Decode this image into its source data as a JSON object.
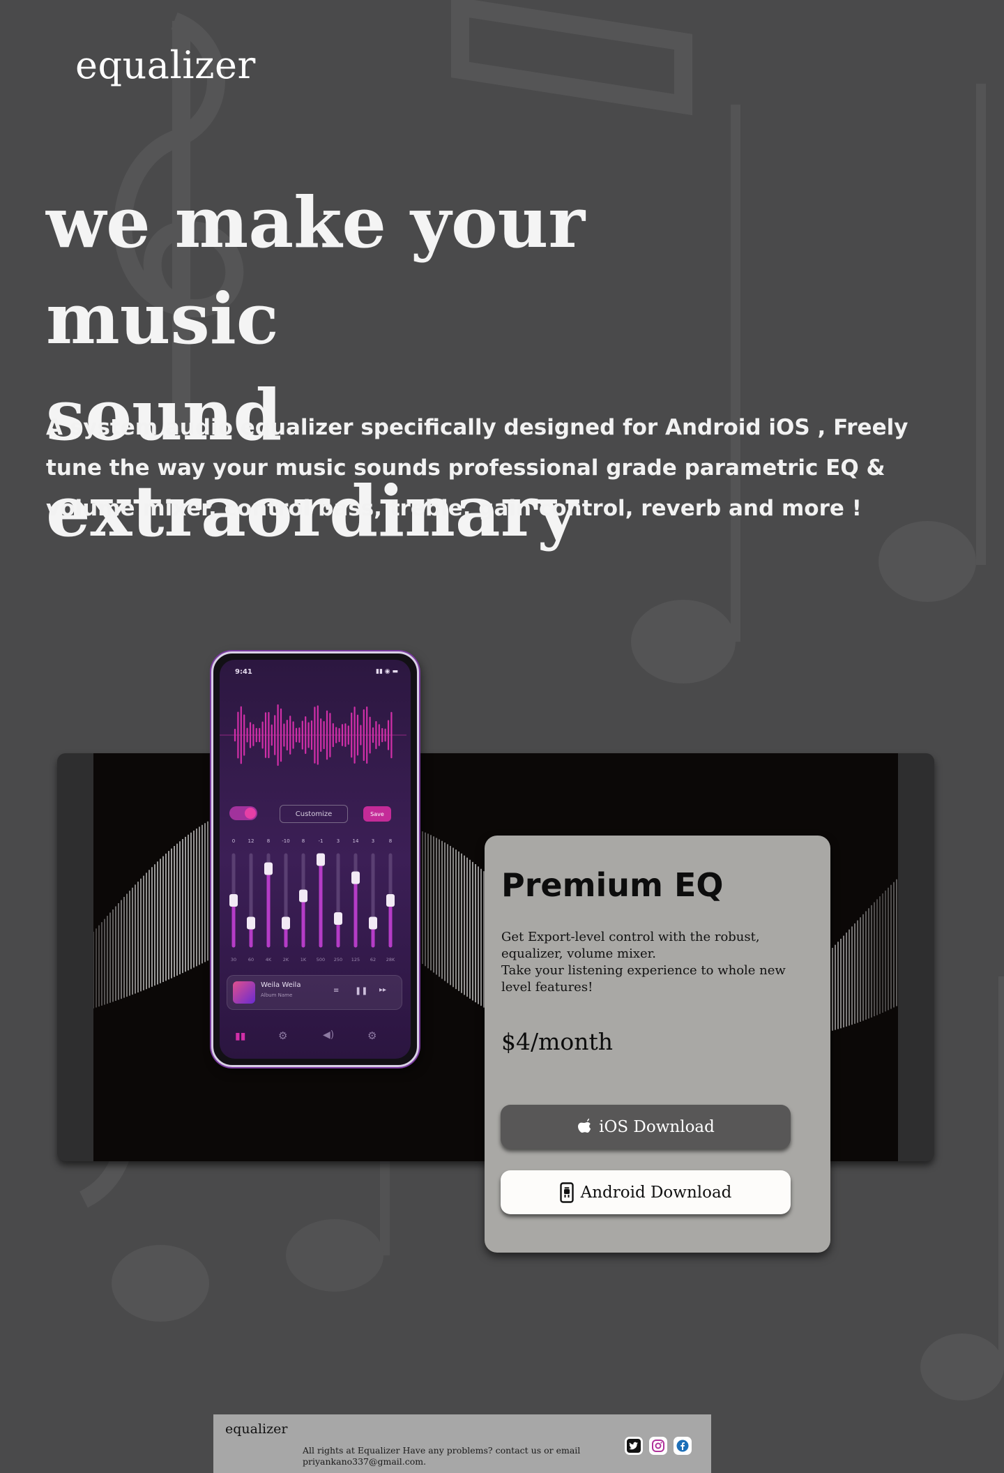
{
  "header": {
    "logo": "equalizer"
  },
  "hero": {
    "title_line1": "we make your music",
    "title_line2": "sound extraordinary",
    "description": "A system audio equalizer specifically designed for Android iOS , Freely  tune the way your music sounds professional grade  parametric EQ & volume mixer, control bass, treble, gain control, reverb and more !"
  },
  "phone": {
    "time": "9:41",
    "toggle_on": true,
    "customize_label": "Customize",
    "save_label": "Save",
    "band_gains": [
      "0",
      "12",
      "8",
      "-10",
      "8",
      "-1",
      "3",
      "14",
      "3",
      "8"
    ],
    "band_levels": [
      0.5,
      0.25,
      0.85,
      0.25,
      0.55,
      0.95,
      0.3,
      0.75,
      0.25,
      0.5
    ],
    "band_freqs": [
      "30",
      "60",
      "4K",
      "2K",
      "1K",
      "500",
      "250",
      "125",
      "62",
      "28K"
    ],
    "now_playing": {
      "title": "Weila Weila",
      "artist": "Album Name"
    },
    "player_controls": [
      "eq-icon",
      "pause-icon",
      "skip-icon"
    ],
    "nav_icons": [
      "equalizer-bars-icon",
      "gear-icon",
      "speaker-icon",
      "settings-icon"
    ],
    "accent_color": "#d12fa8",
    "slider_color": "#b53cc7"
  },
  "card": {
    "title": "Premium EQ",
    "description_line1": "Get Export-level control with the robust, equalizer, volume mixer.",
    "description_line2": "Take your listening experience to whole new level features!",
    "price": "$4/month",
    "ios_button": {
      "label": "iOS Download",
      "icon": "apple-icon"
    },
    "android_button": {
      "label": "Android Download",
      "icon": "android-phone-icon"
    }
  },
  "footer": {
    "logo": "equalizer",
    "text": "All rights at Equalizer Have any problems? contact us or email priyankano337@gmail.com.",
    "socials": [
      "twitter-icon",
      "instagram-icon",
      "facebook-icon"
    ]
  }
}
